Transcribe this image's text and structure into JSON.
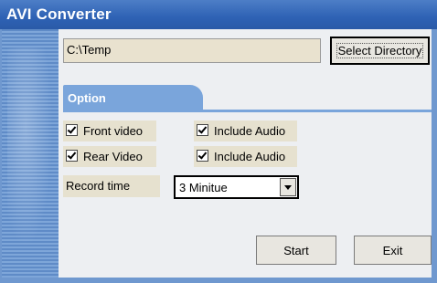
{
  "window": {
    "title": "AVI Converter"
  },
  "directory": {
    "value": "C:\\Temp",
    "button_label": "Select Directory"
  },
  "option_tab": {
    "label": "Option"
  },
  "checkboxes": [
    {
      "label": "Front video",
      "checked": true
    },
    {
      "label": "Include Audio",
      "checked": true
    },
    {
      "label": "Rear Video",
      "checked": true
    },
    {
      "label": "Include Audio",
      "checked": true
    }
  ],
  "record_time": {
    "label": "Record time",
    "selected": "3 Minitue"
  },
  "buttons": {
    "start": "Start",
    "exit": "Exit"
  },
  "colors": {
    "titlebar": "#2e62b4",
    "tab": "#7aa5db",
    "content_bg": "#edeff2",
    "field_bg": "#e6e1cf"
  }
}
